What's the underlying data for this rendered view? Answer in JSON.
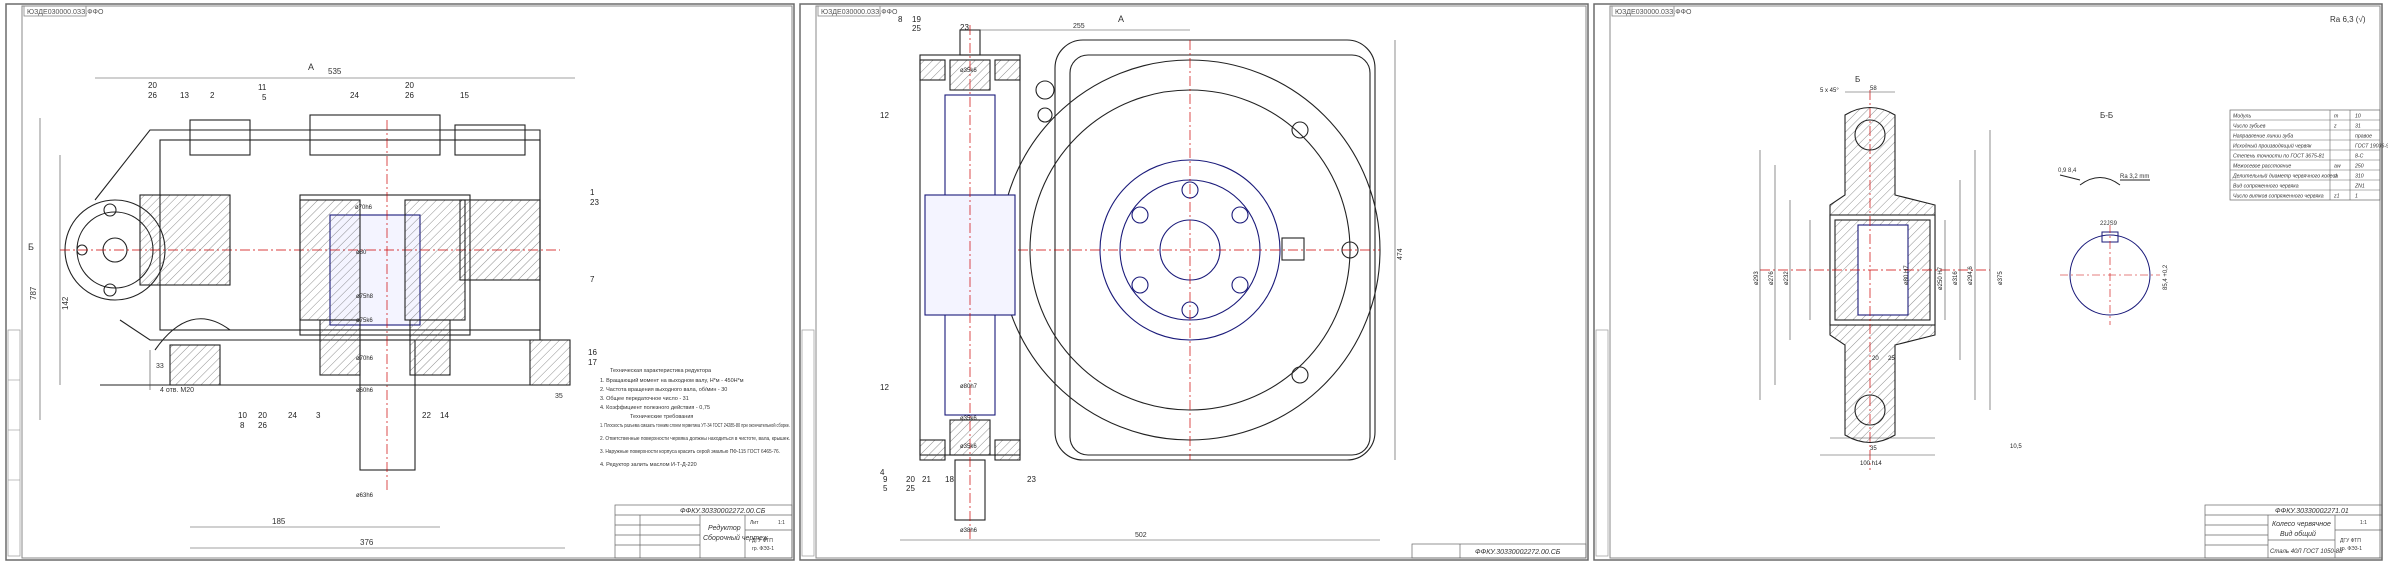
{
  "sheets": [
    {
      "stamp": "ЮЗДЕ030000.0ЗЗ.ФФО",
      "dims": {
        "top": "535",
        "left": "787",
        "h142": "142",
        "bottom1": "185",
        "bottom2": "376",
        "d33": "33",
        "r35": "35",
        "bolt": "4 отв. М20"
      },
      "part_labels": [
        "20",
        "26",
        "13",
        "2",
        "11",
        "5",
        "24",
        "20",
        "26",
        "15",
        "1",
        "23",
        "7",
        "16",
        "17",
        "10",
        "8",
        "20",
        "26",
        "24",
        "3",
        "22",
        "14"
      ],
      "section_marks": {
        "A": "А",
        "B": "Б"
      },
      "shaft_labels": [
        "ø70h6",
        "ø80",
        "ø75h8",
        "ø75k6",
        "ø70h6",
        "ø60h6",
        "ø63h6"
      ],
      "notes_title": "Техническая характеристика редуктора",
      "notes": [
        "1. Вращающий момент на выходном валу, Н*м - 450Н*м",
        "2. Частота вращения выходного вала, об/мин - 30",
        "3. Общее передаточное число - 31",
        "4. Коэффициент полезного действия - 0,75",
        "Технические требования",
        "1. Плоскость разъема смазать тонким слоем герметика УТ-34 ГОСТ 24285-80 при окончательной сборке.",
        "2. Ответственные поверхности червяка должны находиться в чистоте, вала, крышек.",
        "3. Наружные поверхности корпуса красить серой эмалью ПФ-115 ГОСТ 6465-76.",
        "4. Редуктор залить маслом И-Т-Д-220"
      ],
      "title_block": {
        "code": "ФФКУ.30330002272.00.СБ",
        "name1": "Редуктор",
        "name2": "Сборочный чертеж",
        "sheet": "Лит",
        "scale": "1:1",
        "org1": "ДГУ ФТП",
        "org2": "гр. ФЭ3-1"
      }
    },
    {
      "stamp": "ЮЗДЕ030000.0ЗЗ.ФФО",
      "dims": {
        "top": "255",
        "right": "474",
        "bottom": "502"
      },
      "section_mark": "А",
      "part_labels": [
        "8",
        "19",
        "25",
        "23",
        "12",
        "12",
        "9",
        "20",
        "25",
        "5",
        "21",
        "18",
        "23",
        "4"
      ],
      "shaft_labels": [
        "ø35k6",
        "ø80h7",
        "ø35k6",
        "ø35k6",
        "ø38h6"
      ],
      "title_block": {
        "code": "ФФКУ.30330002272.00.СБ"
      }
    },
    {
      "stamp": "ЮЗДЕ030000.0ЗЗ.ФФО",
      "roughness": "Ra 6,3 (√)",
      "dims": {
        "chamfer": "5 x 45°",
        "w58": "58",
        "d293": "ø293",
        "d276": "ø276",
        "d232": "ø232",
        "d316": "ø316",
        "d294": "ø294,6",
        "d250": "ø250 H7",
        "d80": "ø80 H7",
        "d375": "ø375",
        "kw": "22JS9",
        "kd": "85,4 +0,2",
        "w35": "35",
        "w100": "100 h14",
        "r20": "20",
        "r25": "25",
        "r10": "10,5"
      },
      "section": {
        "mark": "Б-Б",
        "label": "Б",
        "tol": "0,9 8,4",
        "ra": "Ra 3,2 mm"
      },
      "table": [
        [
          "Модуль",
          "m",
          "10"
        ],
        [
          "Число зубьев",
          "z",
          "31"
        ],
        [
          "Направление линии зуба",
          "",
          "правое"
        ],
        [
          "Исходный производящий червяк",
          "",
          "ГОСТ 19036-94"
        ],
        [
          "Степень точности по ГОСТ 3675-81",
          "",
          "8-С"
        ],
        [
          "Межосевое расстояние",
          "aw",
          "250"
        ],
        [
          "Делительный диаметр червячного колеса",
          "d",
          "310"
        ],
        [
          "Вид сопряженного червяка",
          "",
          "ZN1"
        ],
        [
          "Число витков сопряженного червяка",
          "z1",
          "1"
        ]
      ],
      "title_block": {
        "code": "ФФКУ.30330002271.01",
        "name1": "Колесо червячное",
        "name2": "Вид общий",
        "material": "Сталь 40Л ГОСТ 1050-88",
        "org1": "ДГУ ФТП",
        "org2": "гр. ФЭ3-1",
        "scale": "1:1"
      }
    }
  ]
}
